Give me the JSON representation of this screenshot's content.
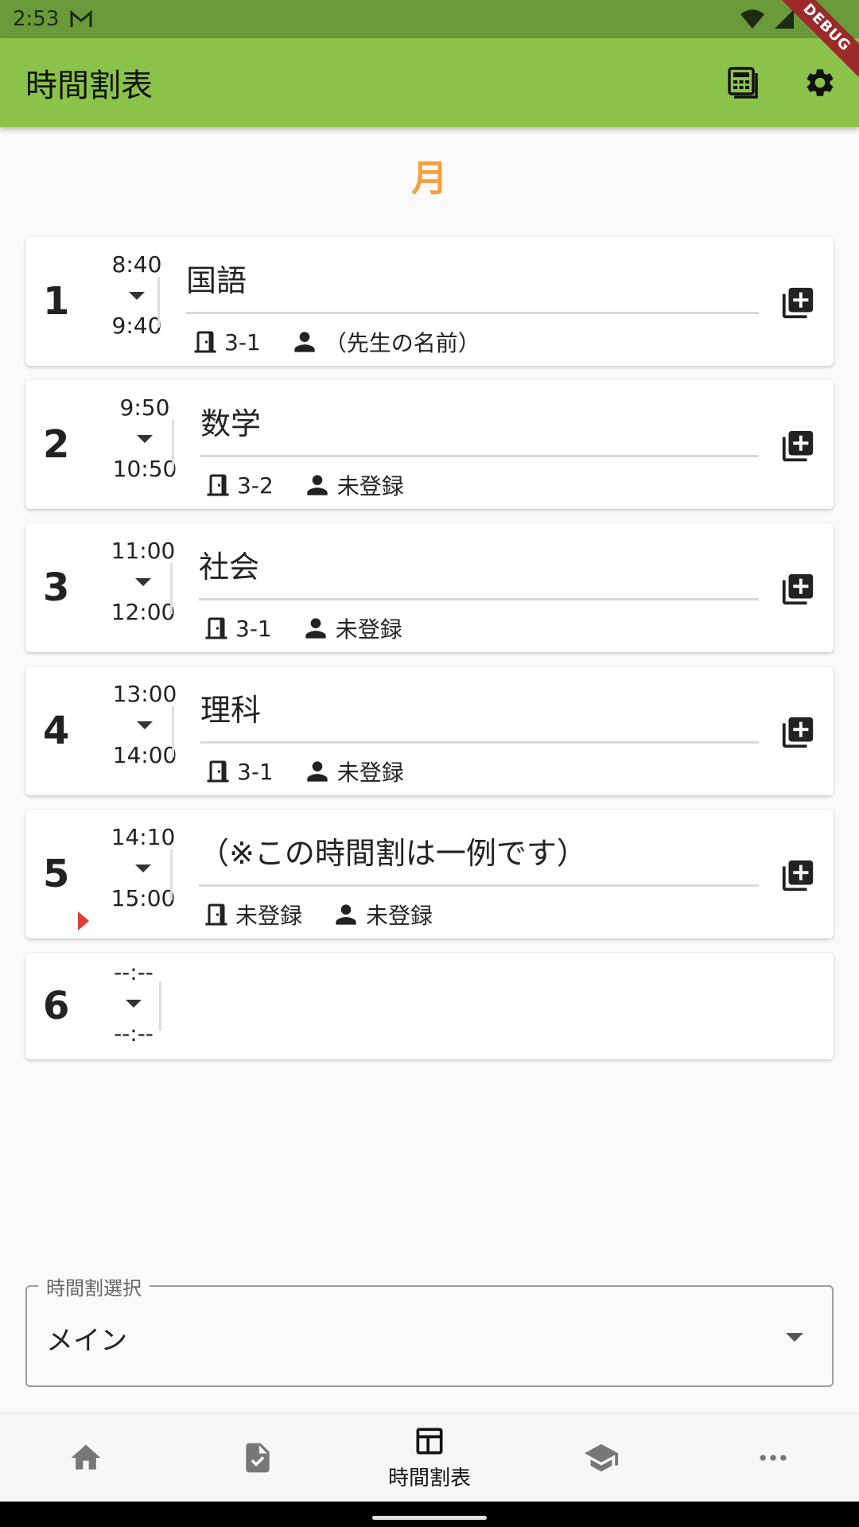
{
  "status_bar": {
    "time": "2:53",
    "debug_label": "DEBUG"
  },
  "app_bar": {
    "title": "時間割表"
  },
  "day": "月",
  "periods": [
    {
      "number": "1",
      "start": "8:40",
      "end": "9:40",
      "subject": "国語",
      "room": "3-1",
      "teacher": "（先生の名前）"
    },
    {
      "number": "2",
      "start": "9:50",
      "end": "10:50",
      "subject": "数学",
      "room": "3-2",
      "teacher": "未登録"
    },
    {
      "number": "3",
      "start": "11:00",
      "end": "12:00",
      "subject": "社会",
      "room": "3-1",
      "teacher": "未登録"
    },
    {
      "number": "4",
      "start": "13:00",
      "end": "14:00",
      "subject": "理科",
      "room": "3-1",
      "teacher": "未登録"
    },
    {
      "number": "5",
      "start": "14:10",
      "end": "15:00",
      "subject": "（※この時間割は一例です）",
      "room": "未登録",
      "teacher": "未登録"
    },
    {
      "number": "6",
      "start": "--:--",
      "end": "--:--"
    }
  ],
  "timetable_select": {
    "label": "時間割選択",
    "value": "メイン"
  },
  "bottom_nav": {
    "items": [
      {
        "icon": "home-icon",
        "label": ""
      },
      {
        "icon": "task-file-icon",
        "label": ""
      },
      {
        "icon": "timetable-icon",
        "label": "時間割表",
        "selected": true
      },
      {
        "icon": "school-icon",
        "label": ""
      },
      {
        "icon": "more-icon",
        "label": ""
      }
    ]
  },
  "colors": {
    "app_bar": "#8bc34a",
    "status_bar": "#6a9a3a",
    "day_accent": "#f4a03c",
    "now_marker": "#e53935"
  }
}
